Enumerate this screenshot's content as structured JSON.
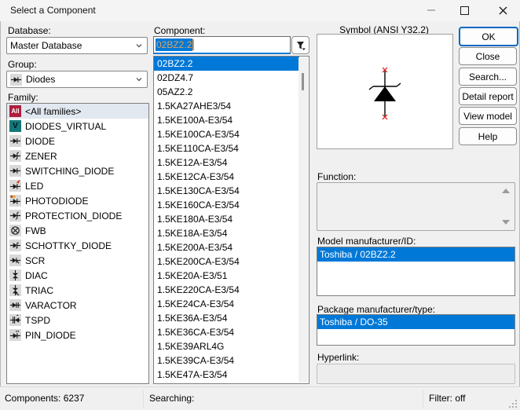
{
  "window": {
    "title": "Select a Component"
  },
  "colors": {
    "accent_selection": "#0078d7",
    "default_button_border": "#0067c0",
    "all_families_red": "#b01e3c",
    "virtual_teal": "#147878",
    "pin_marker_red": "#e03030"
  },
  "left": {
    "database_label": "Database:",
    "database_value": "Master Database",
    "group_label": "Group:",
    "group_value": "Diodes",
    "group_icon": "diode-icon",
    "family_label": "Family:",
    "families": [
      {
        "label": "<All families>",
        "icon": "all-families-icon",
        "selected": true
      },
      {
        "label": "DIODES_VIRTUAL",
        "icon": "virtual-diode-icon"
      },
      {
        "label": "DIODE",
        "icon": "diode-icon"
      },
      {
        "label": "ZENER",
        "icon": "zener-diode-icon"
      },
      {
        "label": "SWITCHING_DIODE",
        "icon": "switching-diode-icon"
      },
      {
        "label": "LED",
        "icon": "led-icon"
      },
      {
        "label": "PHOTODIODE",
        "icon": "photodiode-icon"
      },
      {
        "label": "PROTECTION_DIODE",
        "icon": "protection-diode-icon"
      },
      {
        "label": "FWB",
        "icon": "full-wave-bridge-icon"
      },
      {
        "label": "SCHOTTKY_DIODE",
        "icon": "schottky-diode-icon"
      },
      {
        "label": "SCR",
        "icon": "scr-icon"
      },
      {
        "label": "DIAC",
        "icon": "diac-icon"
      },
      {
        "label": "TRIAC",
        "icon": "triac-icon"
      },
      {
        "label": "VARACTOR",
        "icon": "varactor-icon"
      },
      {
        "label": "TSPD",
        "icon": "tspd-icon"
      },
      {
        "label": "PIN_DIODE",
        "icon": "pin-diode-icon"
      }
    ],
    "all_icon_text": "All",
    "virtual_icon_text": "V"
  },
  "component": {
    "label": "Component:",
    "value": "02BZ2.2",
    "filter_icon": "funnel-filter-icon",
    "selected_index": 0,
    "list": [
      "02BZ2.2",
      "02DZ4.7",
      "05AZ2.2",
      "1.5KA27AHE3/54",
      "1.5KE100A-E3/54",
      "1.5KE100CA-E3/54",
      "1.5KE110CA-E3/54",
      "1.5KE12A-E3/54",
      "1.5KE12CA-E3/54",
      "1.5KE130CA-E3/54",
      "1.5KE160CA-E3/54",
      "1.5KE180A-E3/54",
      "1.5KE18A-E3/54",
      "1.5KE200A-E3/54",
      "1.5KE200CA-E3/54",
      "1.5KE20A-E3/51",
      "1.5KE220CA-E3/54",
      "1.5KE24CA-E3/54",
      "1.5KE36A-E3/54",
      "1.5KE36CA-E3/54",
      "1.5KE39ARL4G",
      "1.5KE39CA-E3/54",
      "1.5KE47A-E3/54"
    ]
  },
  "symbol": {
    "label": "Symbol (ANSI Y32.2)",
    "icon": "zener-diode-symbol"
  },
  "buttons": {
    "ok": "OK",
    "close": "Close",
    "search": "Search...",
    "detail_report": "Detail report",
    "view_model": "View model",
    "help": "Help"
  },
  "function": {
    "label": "Function:",
    "value": ""
  },
  "model": {
    "label": "Model manufacturer/ID:",
    "value": "Toshiba / 02BZ2.2"
  },
  "package": {
    "label": "Package manufacturer/type:",
    "value": "Toshiba / DO-35"
  },
  "hyperlink": {
    "label": "Hyperlink:",
    "value": ""
  },
  "statusbar": {
    "components": "Components: 6237",
    "searching": "Searching:",
    "filter": "Filter: off"
  }
}
